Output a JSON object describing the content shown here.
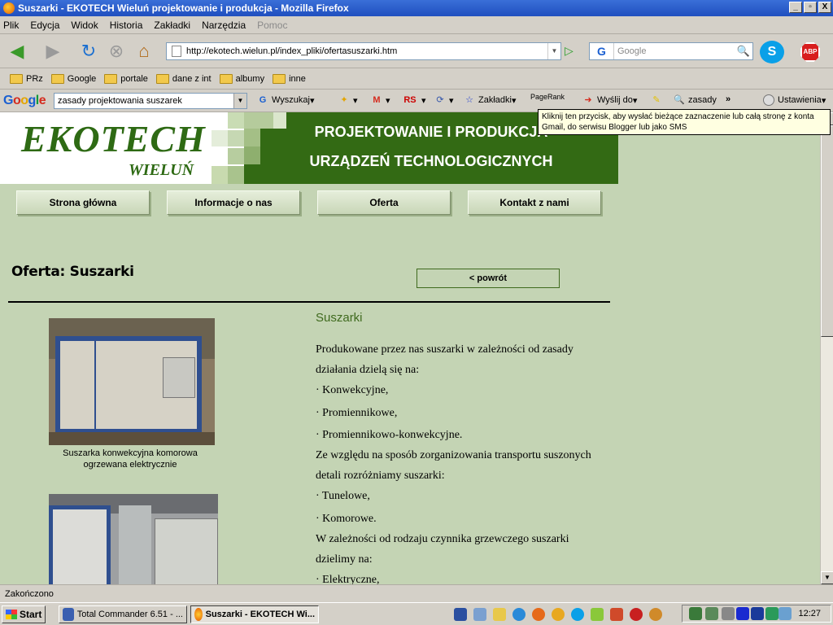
{
  "window": {
    "title": "Suszarki - EKOTECH Wieluń projektowanie i produkcja - Mozilla Firefox",
    "buttons": [
      "_",
      "▫",
      "X"
    ]
  },
  "menu": [
    "Plik",
    "Edycja",
    "Widok",
    "Historia",
    "Zakładki",
    "Narzędzia",
    "Pomoc"
  ],
  "nav": {
    "url": "http://ekotech.wielun.pl/index_pliki/ofertasuszarki.htm",
    "search_placeholder": "Google",
    "search_engine": "G",
    "skype": "S",
    "abp": "ABP"
  },
  "bookmarks": [
    "PRz",
    "Google",
    "portale",
    "dane z int",
    "albumy",
    "inne"
  ],
  "google_toolbar": {
    "logo": [
      "G",
      "o",
      "o",
      "g",
      "l",
      "e"
    ],
    "query": "zasady projektowania suszarek",
    "search_label": "Wyszukaj",
    "bookmarks_label": "Zakładki",
    "pagerank_label": "PageRank",
    "send_label": "Wyślij do",
    "term_label": "zasady",
    "more": "»",
    "settings_label": "Ustawienia",
    "tooltip": "Kliknij ten przycisk, aby wysłać bieżące zaznaczenie lub całą stronę z konta Gmail, do serwisu Blogger lub jako SMS"
  },
  "site": {
    "logo": "EKOTECH",
    "city": "WIELUŃ",
    "banner_line1": "PROJEKTOWANIE I PRODUKCJA",
    "banner_line2": "URZĄDZEŃ TECHNOLOGICZNYCH",
    "menu": [
      "Strona główna",
      "Informacje o nas",
      "Oferta",
      "Kontakt z nami"
    ],
    "page_title": "Oferta: Suszarki",
    "back": "< powrót",
    "section_title": "Suszarki",
    "caption1": "Suszarka konwekcyjna komorowa ogrzewana elektrycznie",
    "paragraphs": [
      "Produkowane przez nas suszarki w zależności od zasady",
      "działania dzielą się na:",
      "· Konwekcyjne,",
      "· Promiennikowe,",
      "· Promiennikowo-konwekcyjne.",
      "Ze względu na sposób zorganizowania transportu suszonych",
      "detali rozróżniamy suszarki:",
      "· Tunelowe,",
      "· Komorowe.",
      "W zależności od rodzaju czynnika grzewczego suszarki",
      "dzielimy na:",
      "· Elektryczne,"
    ]
  },
  "status": "Zakończono",
  "taskbar": {
    "start": "Start",
    "tasks": [
      "Total Commander 6.51 - ...",
      "Suszarki - EKOTECH Wi..."
    ],
    "clock": "12:27"
  }
}
